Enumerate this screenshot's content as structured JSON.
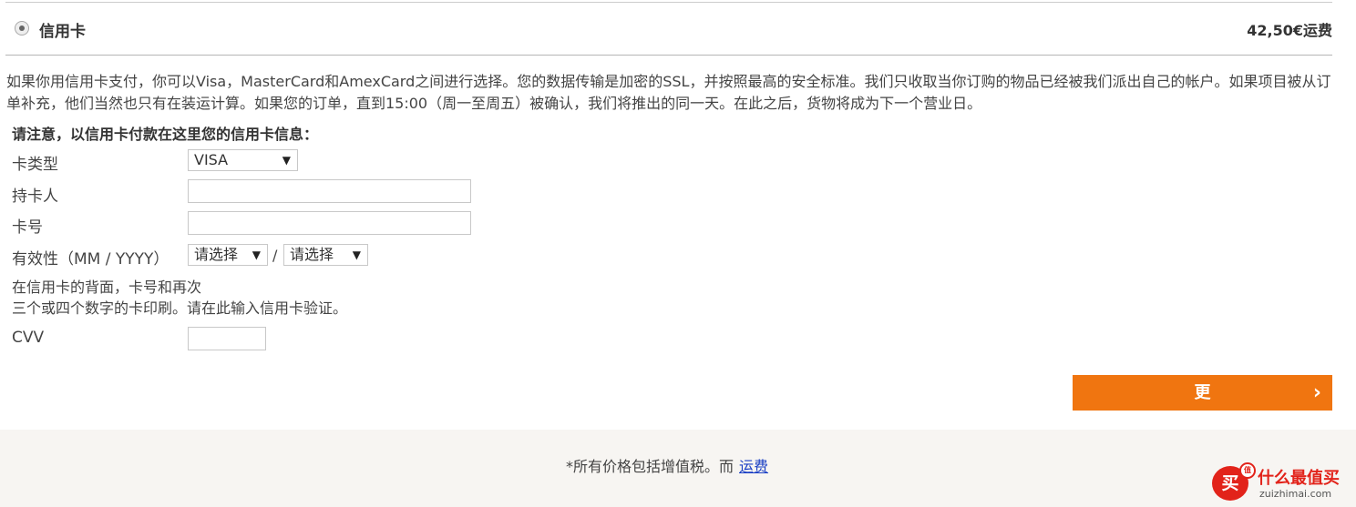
{
  "payment_method": {
    "label": "信用卡",
    "shipping_cost": "42,50€运费",
    "selected": true
  },
  "description": "如果你用信用卡支付，你可以Visa，MasterCard和AmexCard之间进行选择。您的数据传输是加密的SSL，并按照最高的安全标准。我们只收取当你订购的物品已经被我们派出自己的帐户。如果项目被从订单补充，他们当然也只有在装运计算。如果您的订单，直到15:00（周一至周五）被确认，我们将推出的同一天。在此之后，货物将成为下一个营业日。",
  "notice": "请注意，以信用卡付款在这里您的信用卡信息：",
  "form": {
    "card_type_label": "卡类型",
    "card_type_value": "VISA",
    "holder_label": "持卡人",
    "holder_value": "",
    "number_label": "卡号",
    "number_value": "",
    "expiry_label": "有效性（MM / YYYY）",
    "expiry_month_value": "请选择",
    "expiry_separator": "/",
    "expiry_year_value": "请选择",
    "cvv_help_line1": "在信用卡的背面，卡号和再次",
    "cvv_help_line2": "三个或四个数字的卡印刷。请在此输入信用卡验证。",
    "cvv_label": "CVV",
    "cvv_value": ""
  },
  "next_button": {
    "label": "更",
    "chevron": "›"
  },
  "footer": {
    "text": "*所有价格包括增值税。而",
    "link": "运费"
  },
  "watermark": {
    "seal_char": "买",
    "badge": "值",
    "name_cn": "什么最值买",
    "name_en": "zuizhimai.com"
  },
  "colors": {
    "accent": "#f07510",
    "link": "#1a3fc4",
    "footer_bg": "#f7f5f2",
    "watermark": "#e2231a"
  }
}
